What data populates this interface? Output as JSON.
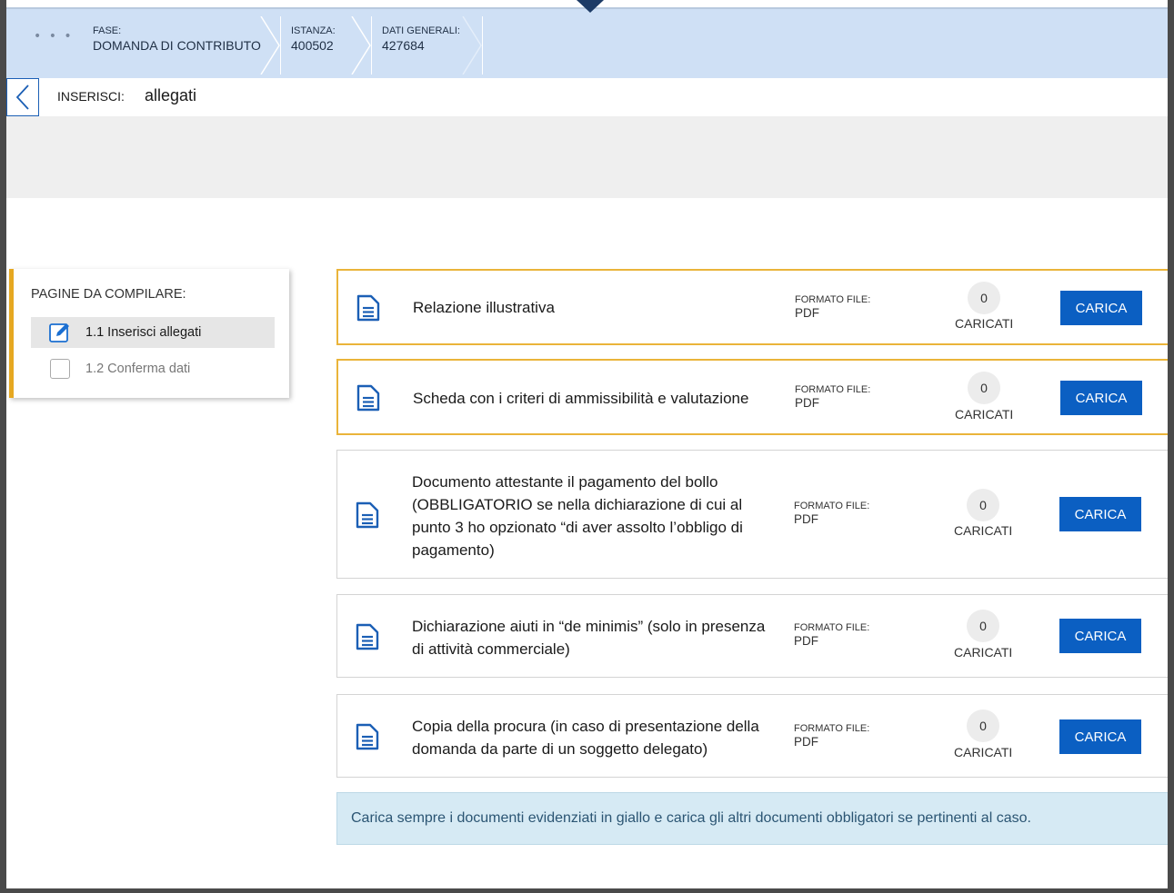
{
  "header": {
    "more_dots": "• • •",
    "crumbs": [
      {
        "label": "FASE:",
        "value": "DOMANDA DI CONTRIBUTO"
      },
      {
        "label": "ISTANZA:",
        "value": "400502"
      },
      {
        "label": "DATI GENERALI:",
        "value": "427684"
      }
    ]
  },
  "toolbar": {
    "insert_label": "INSERISCI:",
    "insert_value": "allegati"
  },
  "sidebar": {
    "title": "PAGINE DA COMPILARE:",
    "items": [
      {
        "label": "1.1 Inserisci allegati",
        "state": "active"
      },
      {
        "label": "1.2 Conferma dati",
        "state": "inactive"
      }
    ]
  },
  "documents": [
    {
      "title": "Relazione illustrativa",
      "format_label": "FORMATO FILE:",
      "format_value": "PDF",
      "count": "0",
      "count_label": "CARICATI",
      "button_label": "CARICA",
      "highlight": true
    },
    {
      "title": "Scheda con i criteri di ammissibilità e valutazione",
      "format_label": "FORMATO FILE:",
      "format_value": "PDF",
      "count": "0",
      "count_label": "CARICATI",
      "button_label": "CARICA",
      "highlight": true
    },
    {
      "title": "Documento attestante il pagamento del bollo (OBBLIGATORIO se nella dichiarazione di cui al punto 3 ho opzionato “di aver assolto l’obbligo di pagamento)",
      "format_label": "FORMATO FILE:",
      "format_value": "PDF",
      "count": "0",
      "count_label": "CARICATI",
      "button_label": "CARICA",
      "highlight": false
    },
    {
      "title": "Dichiarazione aiuti in “de minimis” (solo in presenza di attività commerciale)",
      "format_label": "FORMATO FILE:",
      "format_value": "PDF",
      "count": "0",
      "count_label": "CARICATI",
      "button_label": "CARICA",
      "highlight": false
    },
    {
      "title": "Copia della procura (in caso di presentazione della domanda da parte di un soggetto delegato)",
      "format_label": "FORMATO FILE:",
      "format_value": "PDF",
      "count": "0",
      "count_label": "CARICATI",
      "button_label": "CARICA",
      "highlight": false
    }
  ],
  "notice": {
    "text": "Carica sempre i documenti evidenziati in giallo e carica gli altri documenti obbligatori se pertinenti al caso."
  },
  "colors": {
    "header_bg": "#cfe0f5",
    "primary_button": "#0b5fc2",
    "highlight_border": "#eab43a",
    "notice_bg": "#d6eaf4"
  }
}
